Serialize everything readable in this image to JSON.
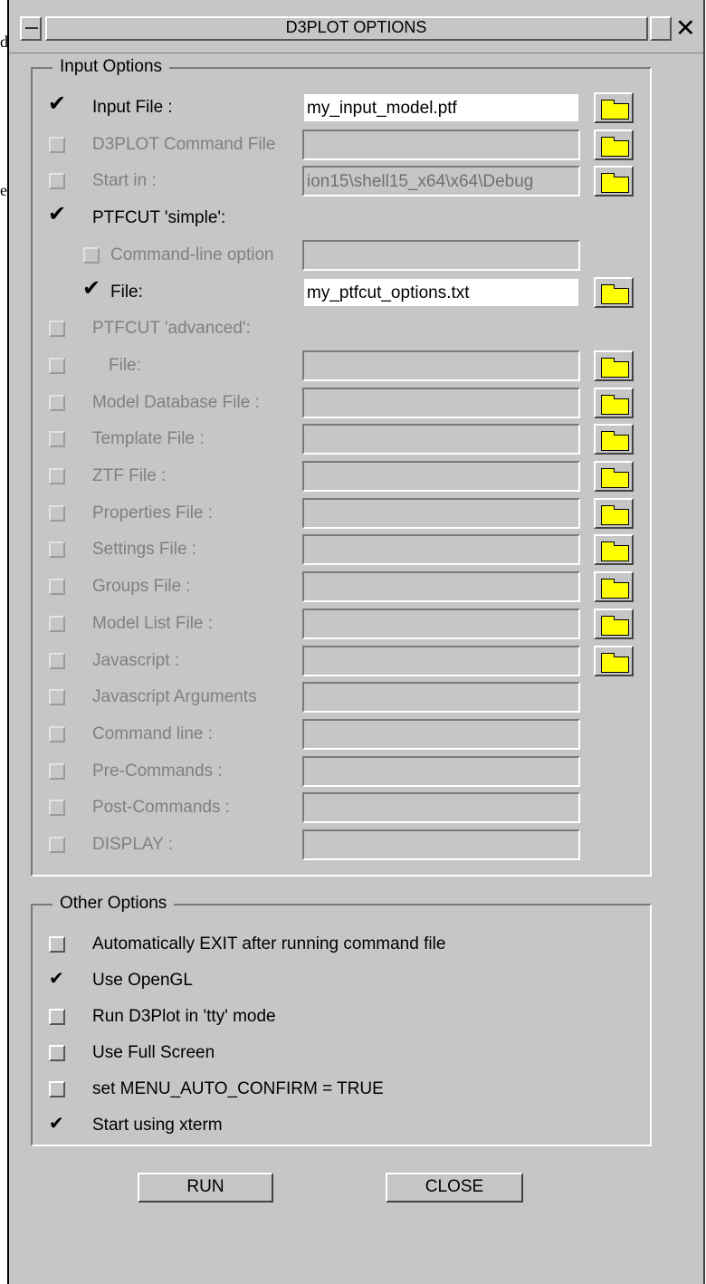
{
  "window": {
    "title": "D3PLOT OPTIONS"
  },
  "background": {
    "char1": "d",
    "char2": "e"
  },
  "input_options": {
    "legend": "Input Options",
    "rows": [
      {
        "label": "Input File :",
        "checked": true,
        "enabled": true,
        "value": "my_input_model.ptf",
        "field": "active",
        "folder": true
      },
      {
        "label": "D3PLOT Command File",
        "checked": false,
        "enabled": false,
        "value": "",
        "field": "inactive",
        "folder": true
      },
      {
        "label": "Start in :",
        "checked": false,
        "enabled": false,
        "value": "ion15\\shell15_x64\\x64\\Debug",
        "field": "inactive",
        "folder": true
      },
      {
        "label": "PTFCUT 'simple':",
        "checked": true,
        "enabled": true,
        "value": "",
        "field": "none",
        "folder": false
      },
      {
        "label": "Command-line option",
        "checked": false,
        "enabled": false,
        "value": "",
        "field": "inactive",
        "folder": false
      },
      {
        "label": "File:",
        "checked": true,
        "enabled": true,
        "value": "my_ptfcut_options.txt",
        "field": "active",
        "folder": true
      },
      {
        "label": "PTFCUT 'advanced':",
        "checked": false,
        "enabled": false,
        "value": "",
        "field": "none",
        "folder": false
      },
      {
        "label": "File:",
        "checked": false,
        "enabled": false,
        "value": "",
        "field": "inactive",
        "folder": true
      },
      {
        "label": "Model Database File :",
        "checked": false,
        "enabled": false,
        "value": "",
        "field": "inactive",
        "folder": true
      },
      {
        "label": "Template File :",
        "checked": false,
        "enabled": false,
        "value": "",
        "field": "inactive",
        "folder": true
      },
      {
        "label": "ZTF File :",
        "checked": false,
        "enabled": false,
        "value": "",
        "field": "inactive",
        "folder": true
      },
      {
        "label": "Properties File :",
        "checked": false,
        "enabled": false,
        "value": "",
        "field": "inactive",
        "folder": true
      },
      {
        "label": "Settings File :",
        "checked": false,
        "enabled": false,
        "value": "",
        "field": "inactive",
        "folder": true
      },
      {
        "label": "Groups File :",
        "checked": false,
        "enabled": false,
        "value": "",
        "field": "inactive",
        "folder": true
      },
      {
        "label": "Model List File :",
        "checked": false,
        "enabled": false,
        "value": "",
        "field": "inactive",
        "folder": true
      },
      {
        "label": "Javascript :",
        "checked": false,
        "enabled": false,
        "value": "",
        "field": "inactive",
        "folder": true
      },
      {
        "label": "Javascript Arguments",
        "checked": false,
        "enabled": false,
        "value": "",
        "field": "inactive",
        "folder": false
      },
      {
        "label": "Command line :",
        "checked": false,
        "enabled": false,
        "value": "",
        "field": "inactive",
        "folder": false
      },
      {
        "label": "Pre-Commands :",
        "checked": false,
        "enabled": false,
        "value": "",
        "field": "inactive",
        "folder": false
      },
      {
        "label": "Post-Commands :",
        "checked": false,
        "enabled": false,
        "value": "",
        "field": "inactive",
        "folder": false
      },
      {
        "label": "DISPLAY :",
        "checked": false,
        "enabled": false,
        "value": "",
        "field": "inactive",
        "folder": false
      }
    ]
  },
  "other_options": {
    "legend": "Other Options",
    "items": [
      {
        "label": "Automatically EXIT after running command file",
        "checked": false
      },
      {
        "label": "Use OpenGL",
        "checked": true
      },
      {
        "label": "Run D3Plot in 'tty' mode",
        "checked": false
      },
      {
        "label": "Use Full Screen",
        "checked": false
      },
      {
        "label": "set MENU_AUTO_CONFIRM = TRUE",
        "checked": false
      },
      {
        "label": "Start using xterm",
        "checked": true
      }
    ]
  },
  "buttons": {
    "run": "RUN",
    "close": "CLOSE"
  },
  "icons": {
    "folder": "folder-icon",
    "close": "close-icon",
    "check": "checkmark-icon"
  },
  "colors": {
    "window_bg": "#c6c6c6",
    "folder": "#ffff00",
    "disabled_text": "#808080"
  }
}
